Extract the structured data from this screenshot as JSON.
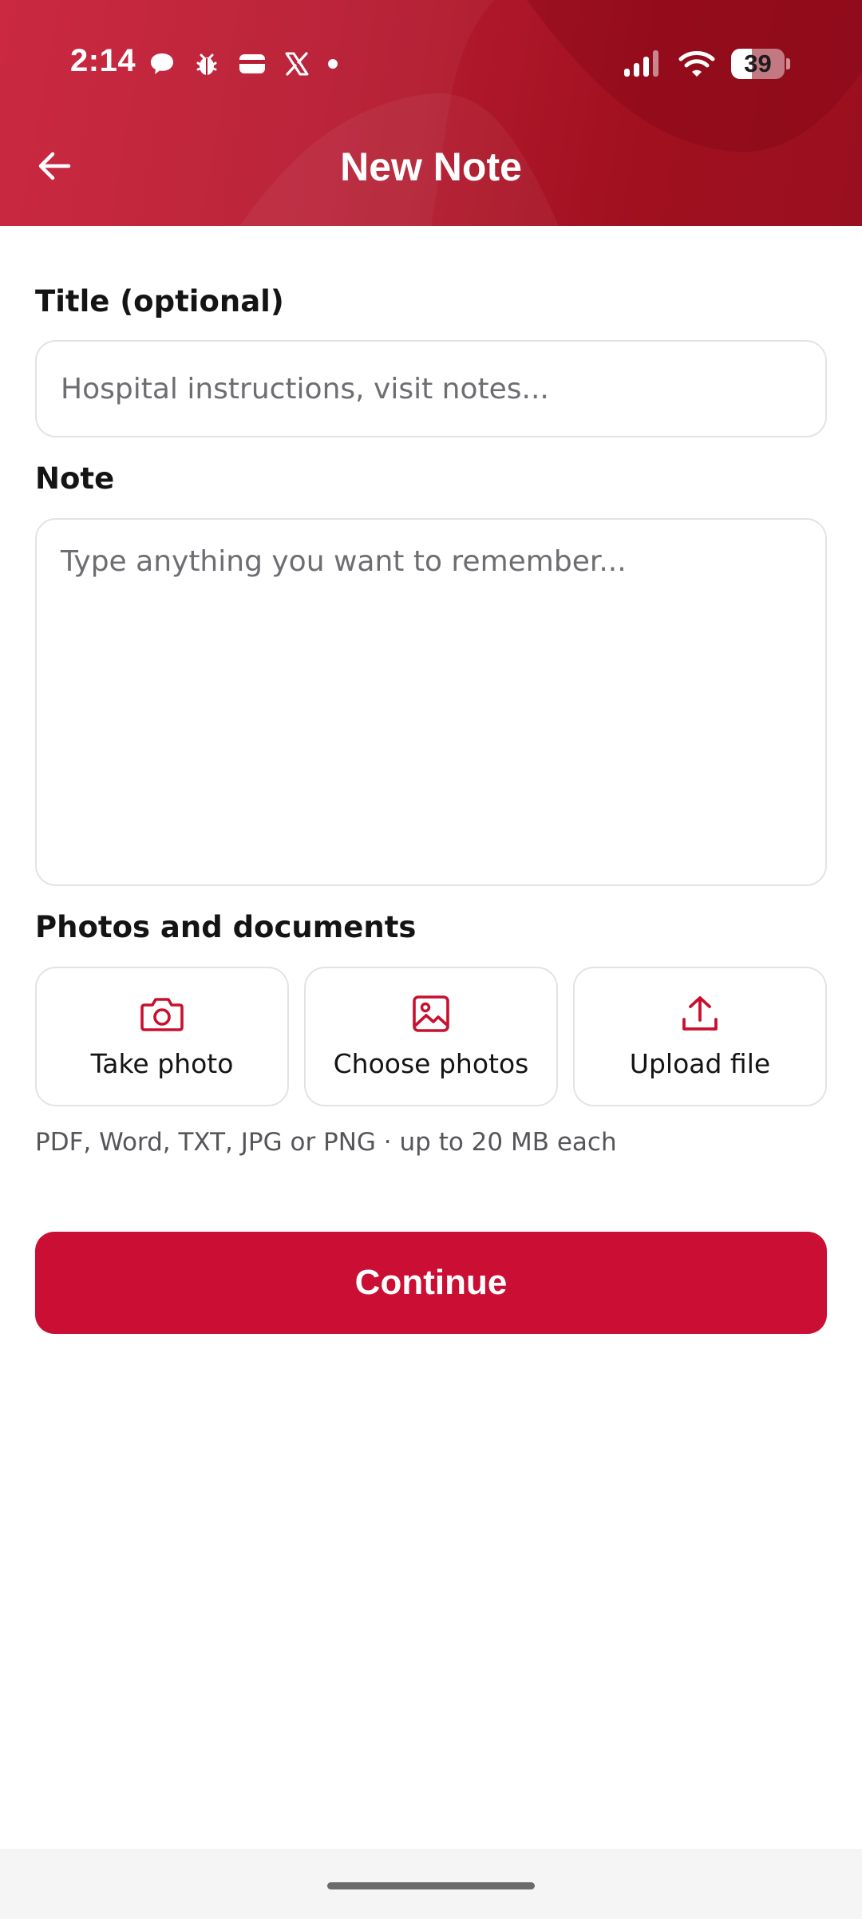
{
  "status_bar": {
    "time": "2:14",
    "battery_level": "39",
    "battery_fraction": 0.39
  },
  "header": {
    "title": "New Note",
    "back_icon": "arrow-left-icon",
    "accent_color": "#c01b33"
  },
  "form": {
    "title_label": "Title (optional)",
    "title_placeholder": "Hospital instructions, visit notes...",
    "title_value": "",
    "note_label": "Note",
    "note_placeholder": "Type anything you want to remember...",
    "note_value": ""
  },
  "attachments": {
    "section_label": "Photos and documents",
    "buttons": [
      {
        "label": "Take photo",
        "icon": "camera-icon"
      },
      {
        "label": "Choose photos",
        "icon": "image-icon"
      },
      {
        "label": "Upload file",
        "icon": "upload-icon"
      }
    ],
    "hint": "PDF, Word, TXT, JPG or PNG · up to 20 MB each"
  },
  "actions": {
    "continue_label": "Continue",
    "continue_color": "#cb0e34"
  }
}
